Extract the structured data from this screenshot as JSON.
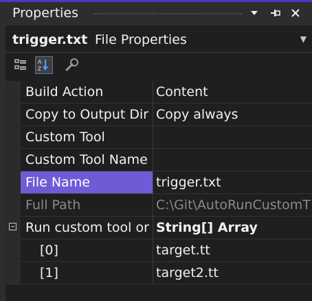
{
  "window": {
    "title": "Properties"
  },
  "object": {
    "name": "trigger.txt",
    "type": "File Properties"
  },
  "toolbar": {
    "buttons": [
      {
        "icon": "categorized-icon",
        "active": false
      },
      {
        "icon": "alphabetical-icon",
        "active": true
      },
      {
        "icon": "property-pages-icon",
        "active": false
      }
    ]
  },
  "grid": {
    "rows": [
      {
        "name": "Build Action",
        "value": "Content"
      },
      {
        "name": "Copy to Output Dir",
        "value": "Copy always"
      },
      {
        "name": "Custom Tool",
        "value": ""
      },
      {
        "name": "Custom Tool Name",
        "value": ""
      },
      {
        "name": "File Name",
        "value": "trigger.txt",
        "selected": true
      },
      {
        "name": "Full Path",
        "value": "C:\\Git\\AutoRunCustomT",
        "readonly": true
      },
      {
        "name": "Run custom tool or",
        "value": "String[] Array",
        "expanded": true
      },
      {
        "name": "[0]",
        "value": "target.tt"
      },
      {
        "name": "[1]",
        "value": "target2.tt"
      }
    ]
  },
  "colors": {
    "accent": "#4a3cc2",
    "selection": "#6f5bd6",
    "background": "#1f1f1f",
    "readonly_text": "#8a8a8a"
  }
}
